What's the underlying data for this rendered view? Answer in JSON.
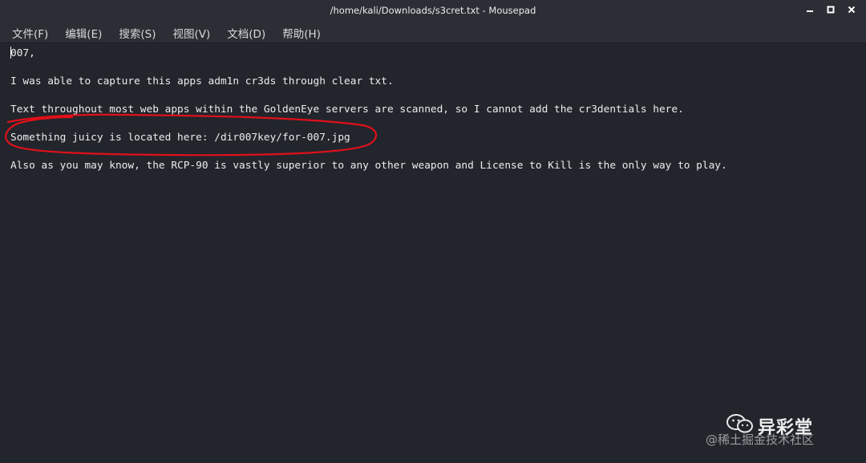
{
  "window": {
    "title": "/home/kali/Downloads/s3cret.txt - Mousepad"
  },
  "menu": {
    "items": [
      {
        "label": "文件(F)"
      },
      {
        "label": "编辑(E)"
      },
      {
        "label": "搜索(S)"
      },
      {
        "label": "视图(V)"
      },
      {
        "label": "文档(D)"
      },
      {
        "label": "帮助(H)"
      }
    ]
  },
  "editor": {
    "lines": [
      "007,",
      "",
      "I was able to capture this apps adm1n cr3ds through clear txt.",
      "",
      "Text throughout most web apps within the GoldenEye servers are scanned, so I cannot add the cr3dentials here.",
      "",
      "Something juicy is located here: /dir007key/for-007.jpg",
      "",
      "Also as you may know, the RCP-90 is vastly superior to any other weapon and License to Kill is the only way to play."
    ]
  },
  "annotation": {
    "color": "#e0101a"
  },
  "watermark": {
    "brand": "异彩堂",
    "source": "@稀土掘金技术社区"
  }
}
